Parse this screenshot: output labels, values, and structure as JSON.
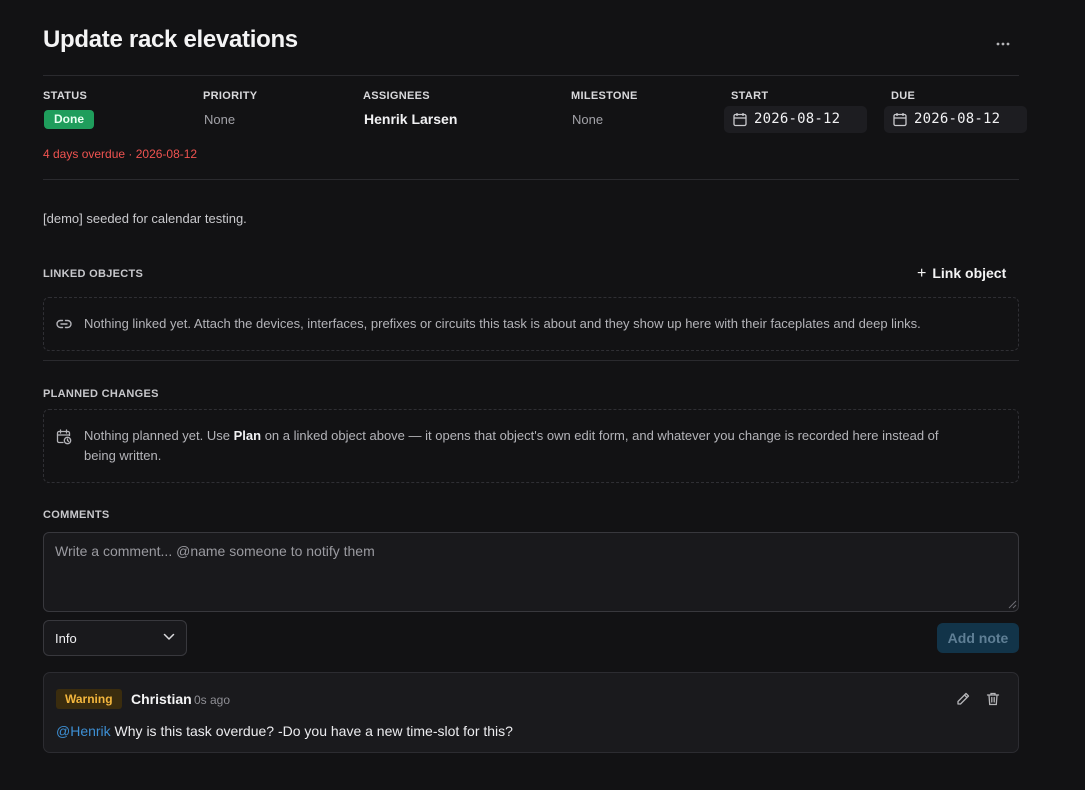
{
  "task": {
    "title": "Update rack elevations",
    "more_label": "···"
  },
  "fields": {
    "status": {
      "label": "STATUS",
      "value": "Done",
      "color": "#1f9d5c"
    },
    "priority": {
      "label": "PRIORITY",
      "value": "None"
    },
    "assignees": {
      "label": "ASSIGNEES",
      "value": "Henrik Larsen"
    },
    "milestone": {
      "label": "MILESTONE",
      "value": "None"
    },
    "start": {
      "label": "START",
      "value": "2026-08-12"
    },
    "due": {
      "label": "DUE",
      "value": "2026-08-12"
    }
  },
  "overdue_text": "4 days overdue · 2026-08-12",
  "description": "[demo] seeded for calendar testing.",
  "linked_objects": {
    "label": "LINKED OBJECTS",
    "link_button": "Link object",
    "link_button_icon": "plus-icon",
    "empty_icon": "link-icon",
    "empty_text": "Nothing linked yet. Attach the devices, interfaces, prefixes or circuits this task is about and they show up here with their faceplates and deep links."
  },
  "planned_changes": {
    "label": "PLANNED CHANGES",
    "empty_icon": "calendar-clock-icon",
    "empty_text_before": "Nothing planned yet. Use ",
    "empty_text_bold": "Plan",
    "empty_text_after_line1": " on a linked object above — it opens that object's own edit form, and whatever you change is recorded here instead of",
    "empty_text_line2": "being written."
  },
  "comments": {
    "label": "COMMENTS",
    "input_placeholder": "Write a comment... @name someone to notify them",
    "level_select": {
      "value": "Info"
    },
    "add_note_label": "Add note",
    "items": [
      {
        "level": "Warning",
        "level_color": "#f3b63d",
        "author": "Christian",
        "time": "0s ago",
        "mention": "@Henrik",
        "text": " Why is this task overdue? -Do you have a new time-slot for this?"
      }
    ]
  },
  "colors": {
    "background": "#121214",
    "overdue": "#ef5350",
    "mention": "#3d8fd4",
    "add_note_bg": "#123449"
  }
}
